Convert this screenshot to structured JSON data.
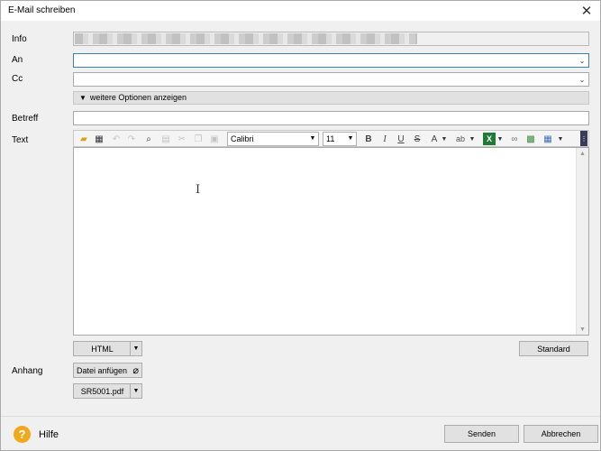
{
  "window": {
    "title": "E-Mail schreiben"
  },
  "labels": {
    "info": "Info",
    "an": "An",
    "cc": "Cc",
    "betreff": "Betreff",
    "text": "Text",
    "anhang": "Anhang"
  },
  "fields": {
    "an_value": "",
    "cc_value": "",
    "betreff_value": ""
  },
  "options_button": "weitere Optionen anzeigen",
  "toolbar": {
    "font": "Calibri",
    "size": "11",
    "icons": [
      "open-folder-icon",
      "template-icon",
      "undo-icon",
      "redo-icon",
      "find-icon",
      "paste-icon",
      "cut-icon",
      "copy-icon",
      "paste-special-icon",
      "bold-icon",
      "italic-icon",
      "underline-icon",
      "strikethrough-icon",
      "font-color-icon",
      "spellcheck-icon",
      "excel-icon",
      "link-icon",
      "image-icon",
      "table-icon"
    ],
    "bold": "B",
    "italic": "I",
    "underline": "U",
    "strike": "S",
    "font_color": "A",
    "spell": "ab"
  },
  "format_button": "HTML",
  "standard_button": "Standard",
  "attach_button": "Datei anfügen",
  "attachment": "SR5001.pdf",
  "footer": {
    "help": "Hilfe",
    "send": "Senden",
    "cancel": "Abbrechen"
  },
  "colors": {
    "accent_border": "#3c7fb1",
    "help_icon": "#f2a81d",
    "excel_green": "#1f7a3a"
  }
}
